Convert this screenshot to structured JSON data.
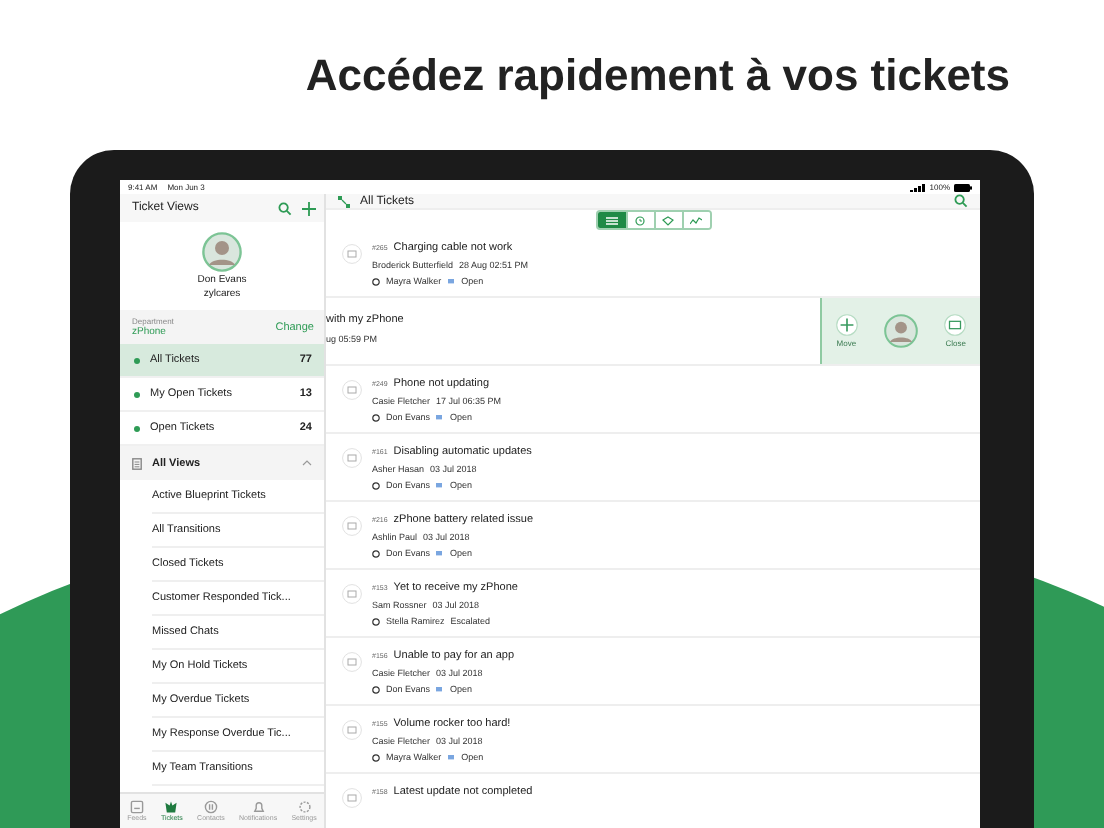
{
  "headline": "Accédez rapidement à vos tickets",
  "status_bar": {
    "time": "9:41 AM",
    "date": "Mon Jun 3",
    "battery": "100%"
  },
  "sidebar": {
    "title": "Ticket Views",
    "profile": {
      "name": "Don Evans",
      "org": "zylcares"
    },
    "department": {
      "label": "Department",
      "value": "zPhone",
      "action": "Change"
    },
    "views": [
      {
        "label": "All Tickets",
        "count": "77",
        "selected": true
      },
      {
        "label": "My Open Tickets",
        "count": "13",
        "selected": false
      },
      {
        "label": "Open Tickets",
        "count": "24",
        "selected": false
      }
    ],
    "all_views": {
      "label": "All Views",
      "expanded": true,
      "items": [
        "Active Blueprint Tickets",
        "All Transitions",
        "Closed Tickets",
        "Customer Responded Tick...",
        "Missed Chats",
        "My On Hold Tickets",
        "My Overdue Tickets",
        "My Response Overdue Tic...",
        "My Team Transitions"
      ]
    }
  },
  "tab_bar": [
    {
      "label": "Feeds",
      "selected": false
    },
    {
      "label": "Tickets",
      "selected": true
    },
    {
      "label": "Contacts",
      "selected": false
    },
    {
      "label": "Notifications",
      "selected": false
    },
    {
      "label": "Settings",
      "selected": false
    }
  ],
  "main": {
    "title": "All Tickets",
    "view_modes": [
      {
        "selected": true
      },
      {
        "selected": false
      },
      {
        "selected": false
      },
      {
        "selected": false
      }
    ],
    "tickets": [
      {
        "kind": "ticket",
        "number": "#265",
        "subject": "Charging cable not work",
        "contact": "Broderick Butterfield",
        "date": "28 Aug 02:51 PM",
        "agent": "Mayra Walker",
        "status": "Open",
        "escalated": false
      },
      {
        "kind": "swiped",
        "subject": "with my zPhone",
        "date": "ug 05:59 PM",
        "actions": [
          "Move",
          "Close"
        ]
      },
      {
        "kind": "ticket",
        "number": "#249",
        "subject": "Phone not updating",
        "contact": "Casie Fletcher",
        "date": "17 Jul 06:35 PM",
        "agent": "Don Evans",
        "status": "Open",
        "escalated": false
      },
      {
        "kind": "ticket",
        "number": "#161",
        "subject": "Disabling automatic updates",
        "contact": "Asher Hasan",
        "date": "03 Jul 2018",
        "agent": "Don Evans",
        "status": "Open",
        "escalated": false
      },
      {
        "kind": "ticket",
        "number": "#216",
        "subject": "zPhone battery related issue",
        "contact": "Ashlin Paul",
        "date": "03 Jul 2018",
        "agent": "Don Evans",
        "status": "Open",
        "escalated": false
      },
      {
        "kind": "ticket",
        "number": "#153",
        "subject": "Yet to receive my zPhone",
        "contact": "Sam Rossner",
        "date": "03 Jul 2018",
        "agent": "Stella Ramirez",
        "status": "Escalated",
        "escalated": true
      },
      {
        "kind": "ticket",
        "number": "#156",
        "subject": "Unable to pay for an app",
        "contact": "Casie Fletcher",
        "date": "03 Jul 2018",
        "agent": "Don Evans",
        "status": "Open",
        "escalated": false
      },
      {
        "kind": "ticket",
        "number": "#155",
        "subject": "Volume rocker too hard!",
        "contact": "Casie Fletcher",
        "date": "03 Jul 2018",
        "agent": "Mayra Walker",
        "status": "Open",
        "escalated": false
      },
      {
        "kind": "title_only",
        "number": "#158",
        "subject": "Latest update not completed"
      }
    ]
  }
}
